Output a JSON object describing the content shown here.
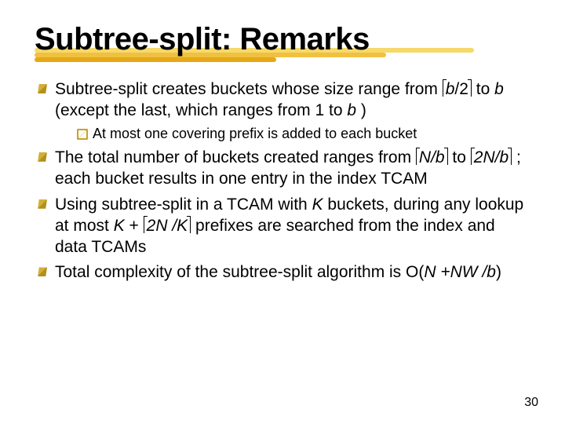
{
  "title": "Subtree-split: Remarks",
  "bullets": {
    "b1a": "Subtree-split creates buckets whose size range from ",
    "b1_expr1_inner": "b",
    "b1_expr1_tail": "/2",
    "b1b": " to ",
    "b1_b": "b",
    "b1c": " (except the last, which ranges from 1 to ",
    "b1_b2": "b",
    "b1d": " )",
    "sub1": "At most one covering prefix is added to each bucket",
    "b2a": "The total number of buckets created ranges from ",
    "b2_expr1": "N/b",
    "b2b": " to ",
    "b2_expr2": "2N/b",
    "b2c": " ; each bucket results in one entry in the index TCAM",
    "b3a": "Using subtree-split in a TCAM with ",
    "b3_K": "K",
    "b3b": "  buckets, during any lookup at most ",
    "b3_Kplus": "K",
    "b3_plus": " + ",
    "b3_expr": "2N /K",
    "b3c": " prefixes are searched from the index and data TCAMs",
    "b4a": "Total complexity of the subtree-split algorithm is O(",
    "b4_expr": "N +NW /b",
    "b4b": ")"
  },
  "page_number": "30"
}
